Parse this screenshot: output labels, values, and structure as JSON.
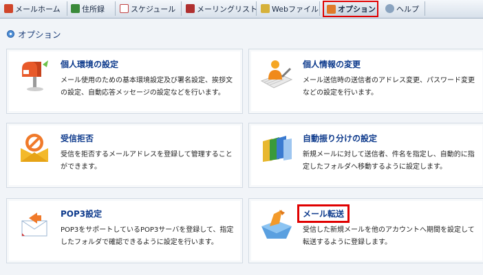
{
  "tabs": [
    {
      "label": "メールホーム",
      "icon": "home-icon",
      "color": "#d0452a"
    },
    {
      "label": "住所録",
      "icon": "address-book-icon",
      "color": "#3a8a3a"
    },
    {
      "label": "スケジュール",
      "icon": "calendar-icon",
      "color": "#c04040"
    },
    {
      "label": "メーリングリスト",
      "icon": "mailing-list-icon",
      "color": "#b03030"
    },
    {
      "label": "Webファイル",
      "icon": "folder-icon",
      "color": "#d6b13a"
    },
    {
      "label": "オプション",
      "icon": "options-icon",
      "color": "#e07a2a",
      "active": true
    },
    {
      "label": "ヘルプ",
      "icon": "help-icon",
      "color": "#8aa3bf"
    }
  ],
  "section_title": "オプション",
  "cards": [
    {
      "title": "個人環境の設定",
      "desc": "メール使用のための基本環境設定及び署名設定、挨拶文の設定、自動応答メッセージの設定などを行います。",
      "icon": "mailbox-icon"
    },
    {
      "title": "個人情報の変更",
      "desc": "メール送信時の送信者のアドレス変更、パスワード変更などの設定を行います。",
      "icon": "user-profile-icon"
    },
    {
      "title": "受信拒否",
      "desc": "受信を拒否するメールアドレスを登録して管理することができます。",
      "icon": "block-mail-icon"
    },
    {
      "title": "自動振り分けの設定",
      "desc": "新規メールに対して送信者、件名を指定し、自動的に指定したフォルダへ移動するように設定します。",
      "icon": "folders-sort-icon"
    },
    {
      "title": "POP3設定",
      "desc": "POP3をサポートしているPOP3サーバを登録して、指定したフォルダで確認できるように設定を行います。",
      "icon": "pop3-mail-icon"
    },
    {
      "title": "メール転送",
      "desc": "受信した新規メールを他のアカウントへ期間を設定して転送するように登録します。",
      "icon": "forward-mail-icon"
    }
  ]
}
